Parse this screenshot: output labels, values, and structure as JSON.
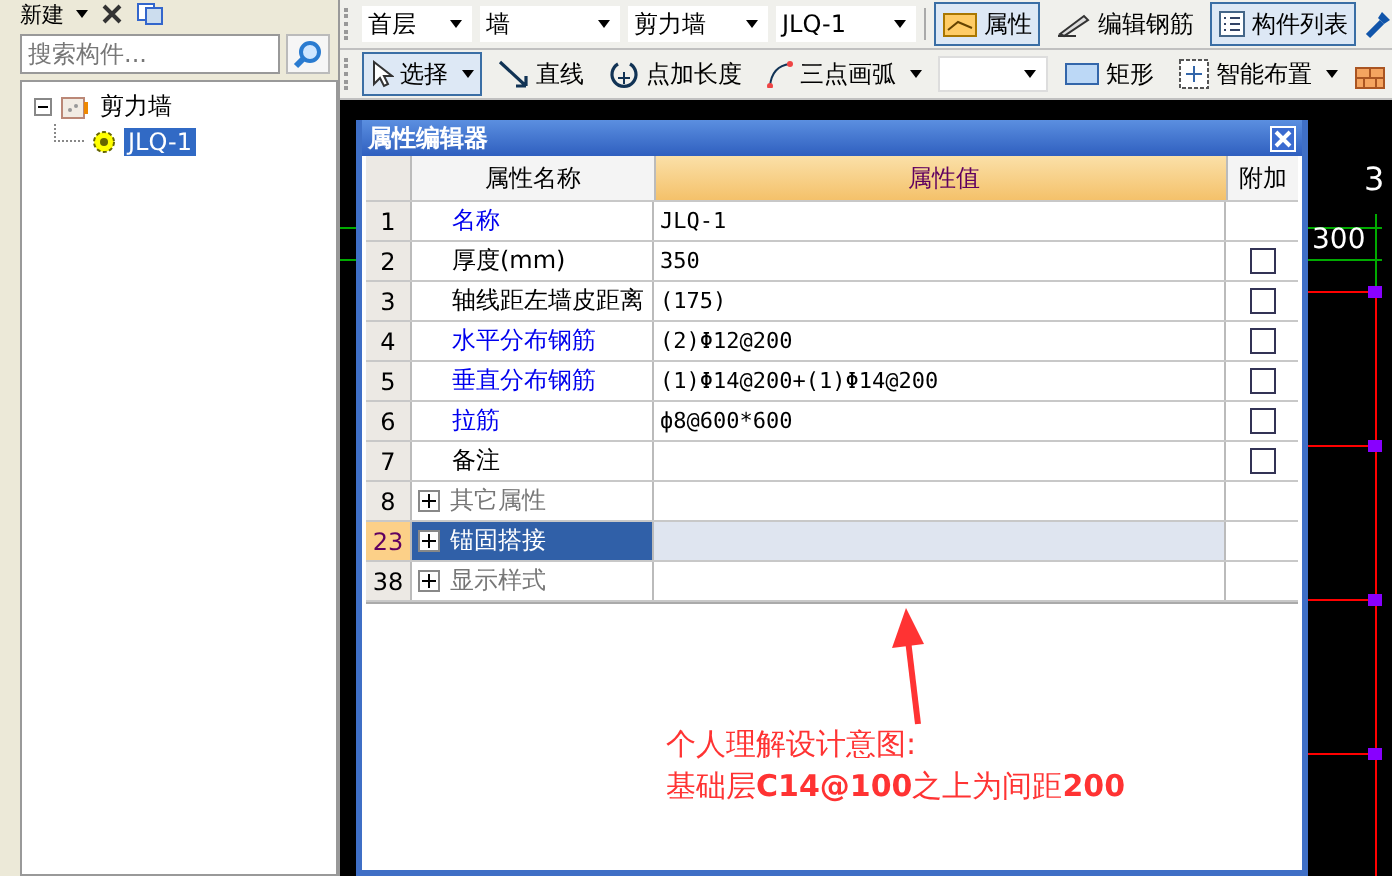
{
  "left_panel": {
    "new_button": "新建",
    "search": {
      "placeholder": "搜索构件..."
    },
    "tree": [
      {
        "label": "剪力墙",
        "expanded": true,
        "children": [
          {
            "label": "JLQ-1",
            "selected": true
          }
        ]
      }
    ]
  },
  "toolbar_1": {
    "combos": [
      "首层",
      "墙",
      "剪力墙",
      "JLQ-1"
    ],
    "buttons": [
      {
        "label": "属性",
        "pressed": true
      },
      {
        "label": "编辑钢筋",
        "pressed": false
      },
      {
        "label": "构件列表",
        "pressed": true
      }
    ]
  },
  "toolbar_2": [
    {
      "kind": "button",
      "label": "选择",
      "pressed": true,
      "dropdown": true
    },
    {
      "kind": "button",
      "label": "直线",
      "pressed": false,
      "dropdown": false
    },
    {
      "kind": "button",
      "label": "点加长度",
      "pressed": false,
      "dropdown": false
    },
    {
      "kind": "button",
      "label": "三点画弧",
      "pressed": false,
      "dropdown": true
    },
    {
      "kind": "combo"
    },
    {
      "kind": "button",
      "label": "矩形",
      "pressed": false,
      "dropdown": false
    },
    {
      "kind": "button",
      "label": "智能布置",
      "pressed": false,
      "dropdown": true
    }
  ],
  "canvas": {
    "axis_label": "3",
    "dimension": "300"
  },
  "dialog": {
    "title": "属性编辑器",
    "columns": [
      "属性名称",
      "属性值",
      "附加"
    ],
    "rows": [
      {
        "kind": "prop",
        "number": "1",
        "name": "名称",
        "value": "JLQ-1",
        "linked": true
      },
      {
        "kind": "prop",
        "number": "2",
        "name": "厚度(mm)",
        "value": "350",
        "linked": false,
        "checked": false
      },
      {
        "kind": "prop",
        "number": "3",
        "name": "轴线距左墙皮距离",
        "value": "(175)",
        "linked": false,
        "checked": false
      },
      {
        "kind": "prop",
        "number": "4",
        "name": "水平分布钢筋",
        "value": "(2)Φ12@200",
        "linked": true,
        "checked": false
      },
      {
        "kind": "prop",
        "number": "5",
        "name": "垂直分布钢筋",
        "value": "(1)Φ14@200+(1)Φ14@200",
        "linked": true,
        "checked": false
      },
      {
        "kind": "prop",
        "number": "6",
        "name": "拉筋",
        "value": "ф8@600*600",
        "linked": true,
        "checked": false
      },
      {
        "kind": "prop",
        "number": "7",
        "name": "备注",
        "value": "",
        "linked": false,
        "checked": false
      },
      {
        "kind": "group",
        "number": "8",
        "name": "其它属性",
        "selected": false,
        "expanded": false
      },
      {
        "kind": "group",
        "number": "23",
        "name": "锚固搭接",
        "selected": true,
        "expanded": false
      },
      {
        "kind": "group",
        "number": "38",
        "name": "显示样式",
        "selected": false,
        "expanded": false
      }
    ]
  },
  "annotation": {
    "lines": [
      "个人理解设计意图:",
      "基础层**C14@100**之上为间距**200**"
    ]
  }
}
